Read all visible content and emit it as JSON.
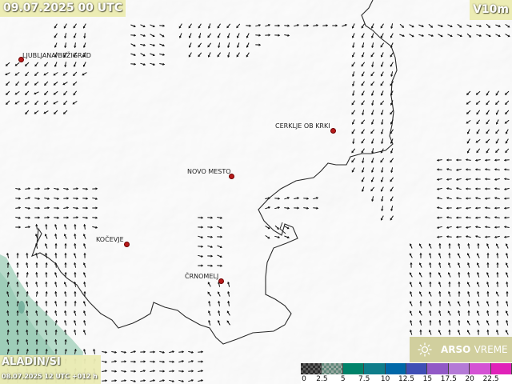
{
  "valid_time": "09.07.2025 00 UTC",
  "parameter": "V10m",
  "model_name": "ALADIN/SI",
  "model_run": "08.07.2025 12 UTC +012 h",
  "logo": {
    "brand": "ARSO",
    "product": "VREME",
    "icon": "sun-icon"
  },
  "cities": [
    {
      "name": "LJUBLJANA/BEŽIGRAD"
    },
    {
      "name": "CERKLJE OB KRKI"
    },
    {
      "name": "NOVO MESTO"
    },
    {
      "name": "KOČEVJE"
    },
    {
      "name": "ČRNOMELJ"
    }
  ],
  "legend": {
    "ticks": [
      "0",
      "2.5",
      "5",
      "7.5",
      "10",
      "12.5",
      "15",
      "17.5",
      "20",
      "22.5"
    ],
    "colors": [
      "#3a3a3a",
      "#6a8f84",
      "#00836a",
      "#0f7d8a",
      "#0068a8",
      "#3f4fb5",
      "#9159c6",
      "#b47ad6",
      "#d452d4",
      "#e022b8"
    ],
    "pattern_colors": [
      "#5e5e5e",
      "#9aa9a2"
    ]
  },
  "map": {
    "arrow_color": "#111111",
    "border_color": "#222222",
    "wind_shade_color": "#9ecbb7"
  }
}
